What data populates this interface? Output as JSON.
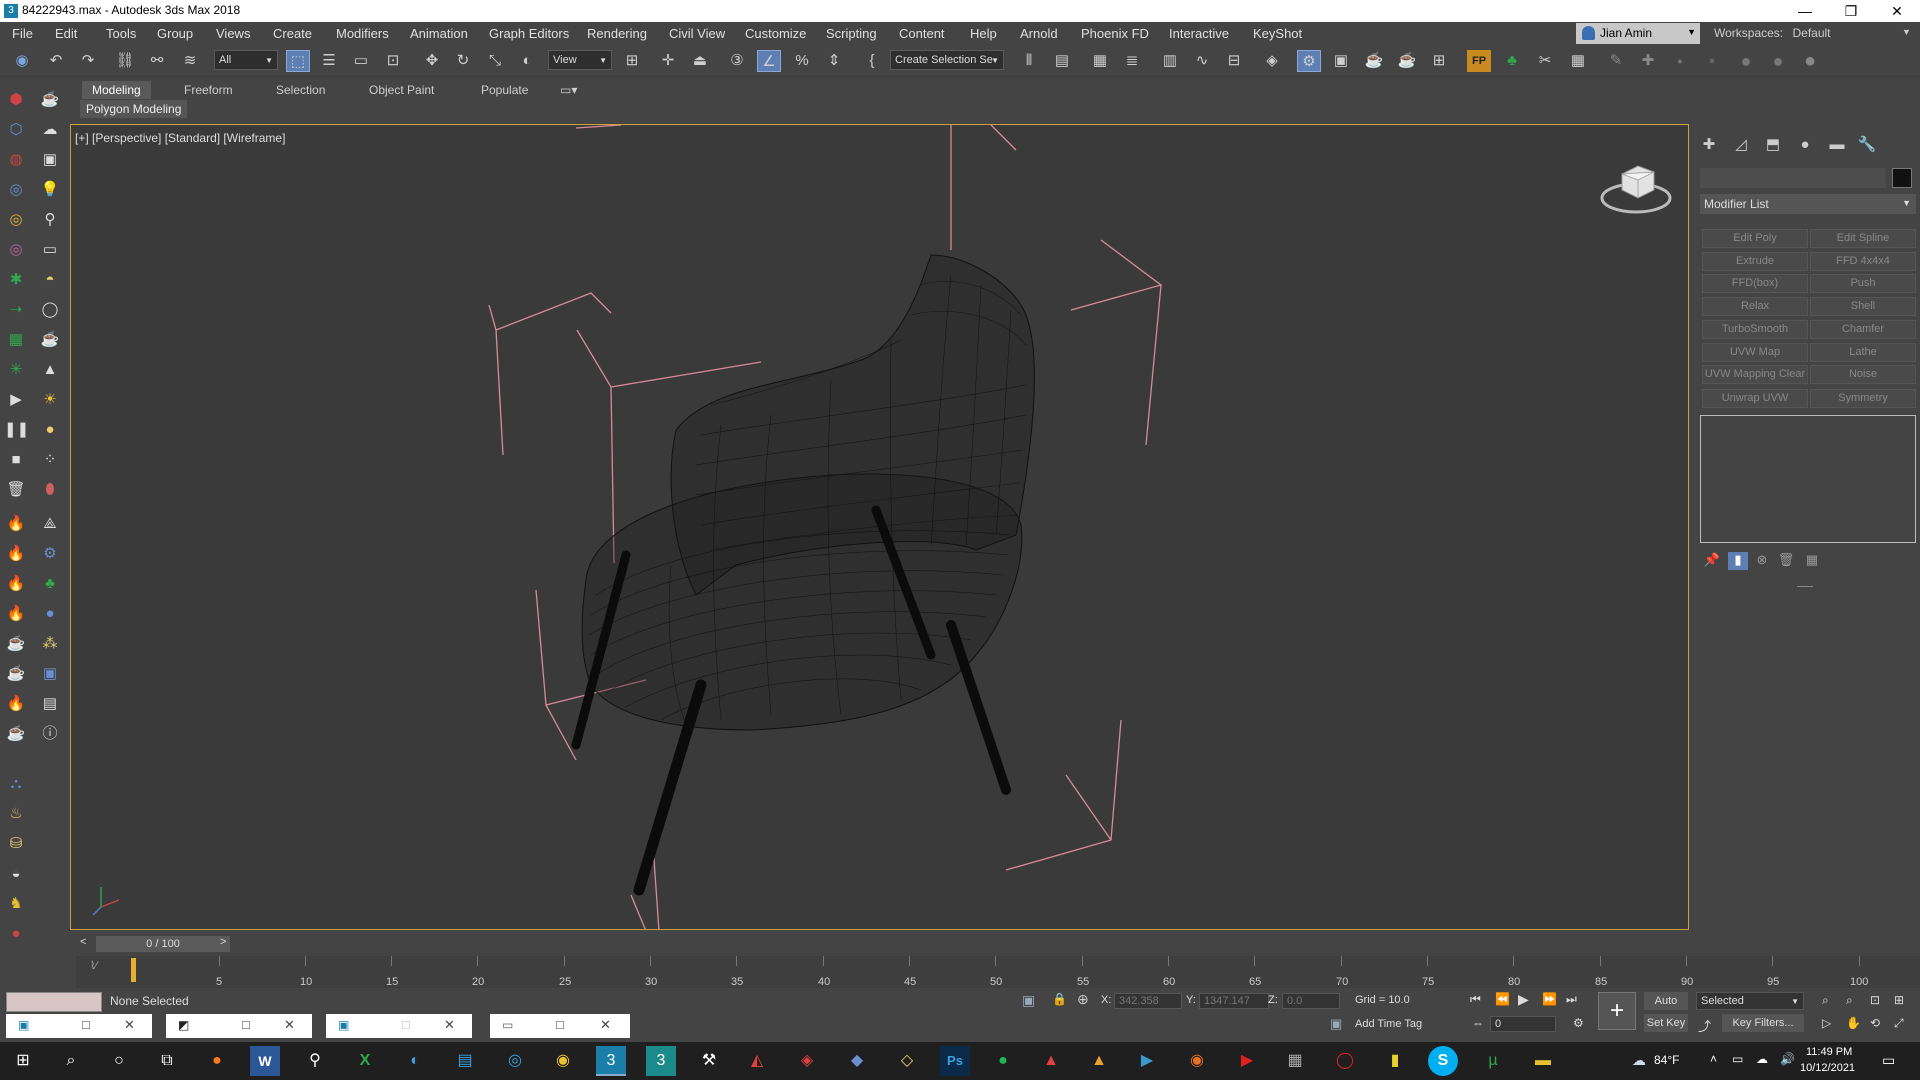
{
  "window": {
    "title": "84222943.max - Autodesk 3ds Max 2018",
    "app_icon": "3"
  },
  "menu": [
    "File",
    "Edit",
    "Tools",
    "Group",
    "Views",
    "Create",
    "Modifiers",
    "Animation",
    "Graph Editors",
    "Rendering",
    "Civil View",
    "Customize",
    "Scripting",
    "Content",
    "Help",
    "Arnold",
    "Phoenix FD",
    "Interactive",
    "KeyShot"
  ],
  "user": {
    "name": "Jian Amin"
  },
  "workspaces": {
    "label": "Workspaces:",
    "value": "Default"
  },
  "toolbar": {
    "filter": "All",
    "ref_coord": "View",
    "selection_set": "Create Selection Se",
    "percent_icon": "%"
  },
  "ribbon": {
    "tabs": [
      "Modeling",
      "Freeform",
      "Selection",
      "Object Paint",
      "Populate"
    ],
    "active": "Modeling",
    "sub": "Polygon Modeling"
  },
  "viewport": {
    "label": "[+] [Perspective] [Standard] [Wireframe]"
  },
  "command_panel": {
    "modifier_list": "Modifier List",
    "buttons": [
      "Edit Poly",
      "Edit Spline",
      "Extrude",
      "FFD 4x4x4",
      "FFD(box)",
      "Push",
      "Relax",
      "Shell",
      "TurboSmooth",
      "Chamfer",
      "UVW Map",
      "Lathe",
      "UVW Mapping Clear",
      "Noise",
      "Unwrap UVW",
      "Symmetry"
    ]
  },
  "timeline": {
    "frame_display": "0 / 100",
    "ticks": [
      "5",
      "10",
      "15",
      "20",
      "25",
      "30",
      "35",
      "40",
      "45",
      "50",
      "55",
      "60",
      "65",
      "70",
      "75",
      "80",
      "85",
      "90",
      "95",
      "100"
    ]
  },
  "status": {
    "selection": "None Selected",
    "x_label": "X:",
    "x_value": "342.358",
    "y_label": "Y:",
    "y_value": "1347.147",
    "z_label": "Z:",
    "z_value": "0.0",
    "grid": "Grid = 10.0",
    "add_time_tag": "Add Time Tag",
    "auto_key": "Auto Key",
    "set_key": "Set Key",
    "key_mode": "Selected",
    "key_filters": "Key Filters...",
    "frame_field": "0"
  },
  "taskbar": {
    "weather": "84°F",
    "time": "11:49 PM",
    "date": "10/12/2021",
    "ps_label": "Ps",
    "word_label": "W",
    "excel_label": "X",
    "skype_label": "S",
    "fp_label": "FP"
  },
  "colors": {
    "accent": "#5d7fb3",
    "viewport_border": "#c9a23b",
    "bbox": "#d98a9a",
    "wire": "#111111"
  }
}
